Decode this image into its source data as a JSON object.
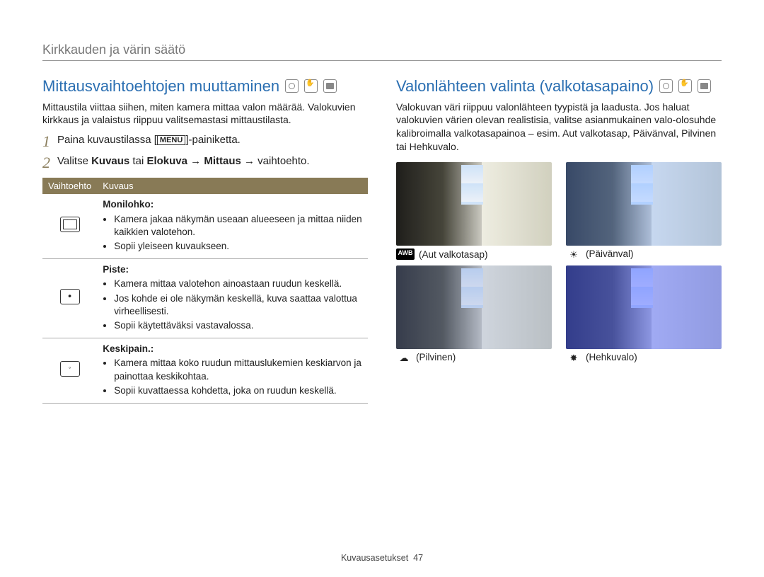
{
  "breadcrumb": "Kirkkauden ja värin säätö",
  "left": {
    "heading": "Mittausvaihtoehtojen muuttaminen",
    "intro": "Mittaustila viittaa siihen, miten kamera mittaa valon määrää. Valokuvien kirkkaus ja valaistus riippuu valitsemastasi mittaustilasta.",
    "step1_pre": "Paina kuvaustilassa [",
    "menu_key": "MENU",
    "step1_post": "]-painiketta.",
    "step2_a": "Valitse ",
    "step2_b": "Kuvaus",
    "step2_c": " tai ",
    "step2_d": "Elokuva",
    "step2_e": " → ",
    "step2_f": "Mittaus",
    "step2_g": " → vaihtoehto.",
    "th_option": "Vaihtoehto",
    "th_desc": "Kuvaus",
    "opts": [
      {
        "title": "Monilohko:",
        "bullets": [
          "Kamera jakaa näkymän useaan alueeseen ja mittaa niiden kaikkien valotehon.",
          "Sopii yleiseen kuvaukseen."
        ]
      },
      {
        "title": "Piste:",
        "bullets": [
          "Kamera mittaa valotehon ainoastaan ruudun keskellä.",
          "Jos kohde ei ole näkymän keskellä, kuva saattaa valottua virheellisesti.",
          "Sopii käytettäväksi vastavalossa."
        ]
      },
      {
        "title": "Keskipain.:",
        "bullets": [
          "Kamera mittaa koko ruudun mittauslukemien keskiarvon ja painottaa keskikohtaa.",
          "Sopii kuvattaessa kohdetta, joka on ruudun keskellä."
        ]
      }
    ]
  },
  "right": {
    "heading": "Valonlähteen valinta (valkotasapaino)",
    "intro": "Valokuvan väri riippuu valonlähteen tyypistä ja laadusta. Jos haluat valokuvien värien olevan realistisia, valitse asianmukainen valo-olosuhde kalibroimalla valkotasapainoa – esim. Aut valkotasap, Päivänval, Pilvinen tai Hehkuvalo.",
    "wb": [
      {
        "label": "(Aut valkotasap)",
        "kind": "auto",
        "icon": "AWB"
      },
      {
        "label": "(Päivänval)",
        "kind": "day",
        "icon": "☀"
      },
      {
        "label": "(Pilvinen)",
        "kind": "cloud",
        "icon": "☁"
      },
      {
        "label": "(Hehkuvalo)",
        "kind": "tung",
        "icon": "✸"
      }
    ]
  },
  "footer_label": "Kuvausasetukset",
  "footer_page": "47"
}
